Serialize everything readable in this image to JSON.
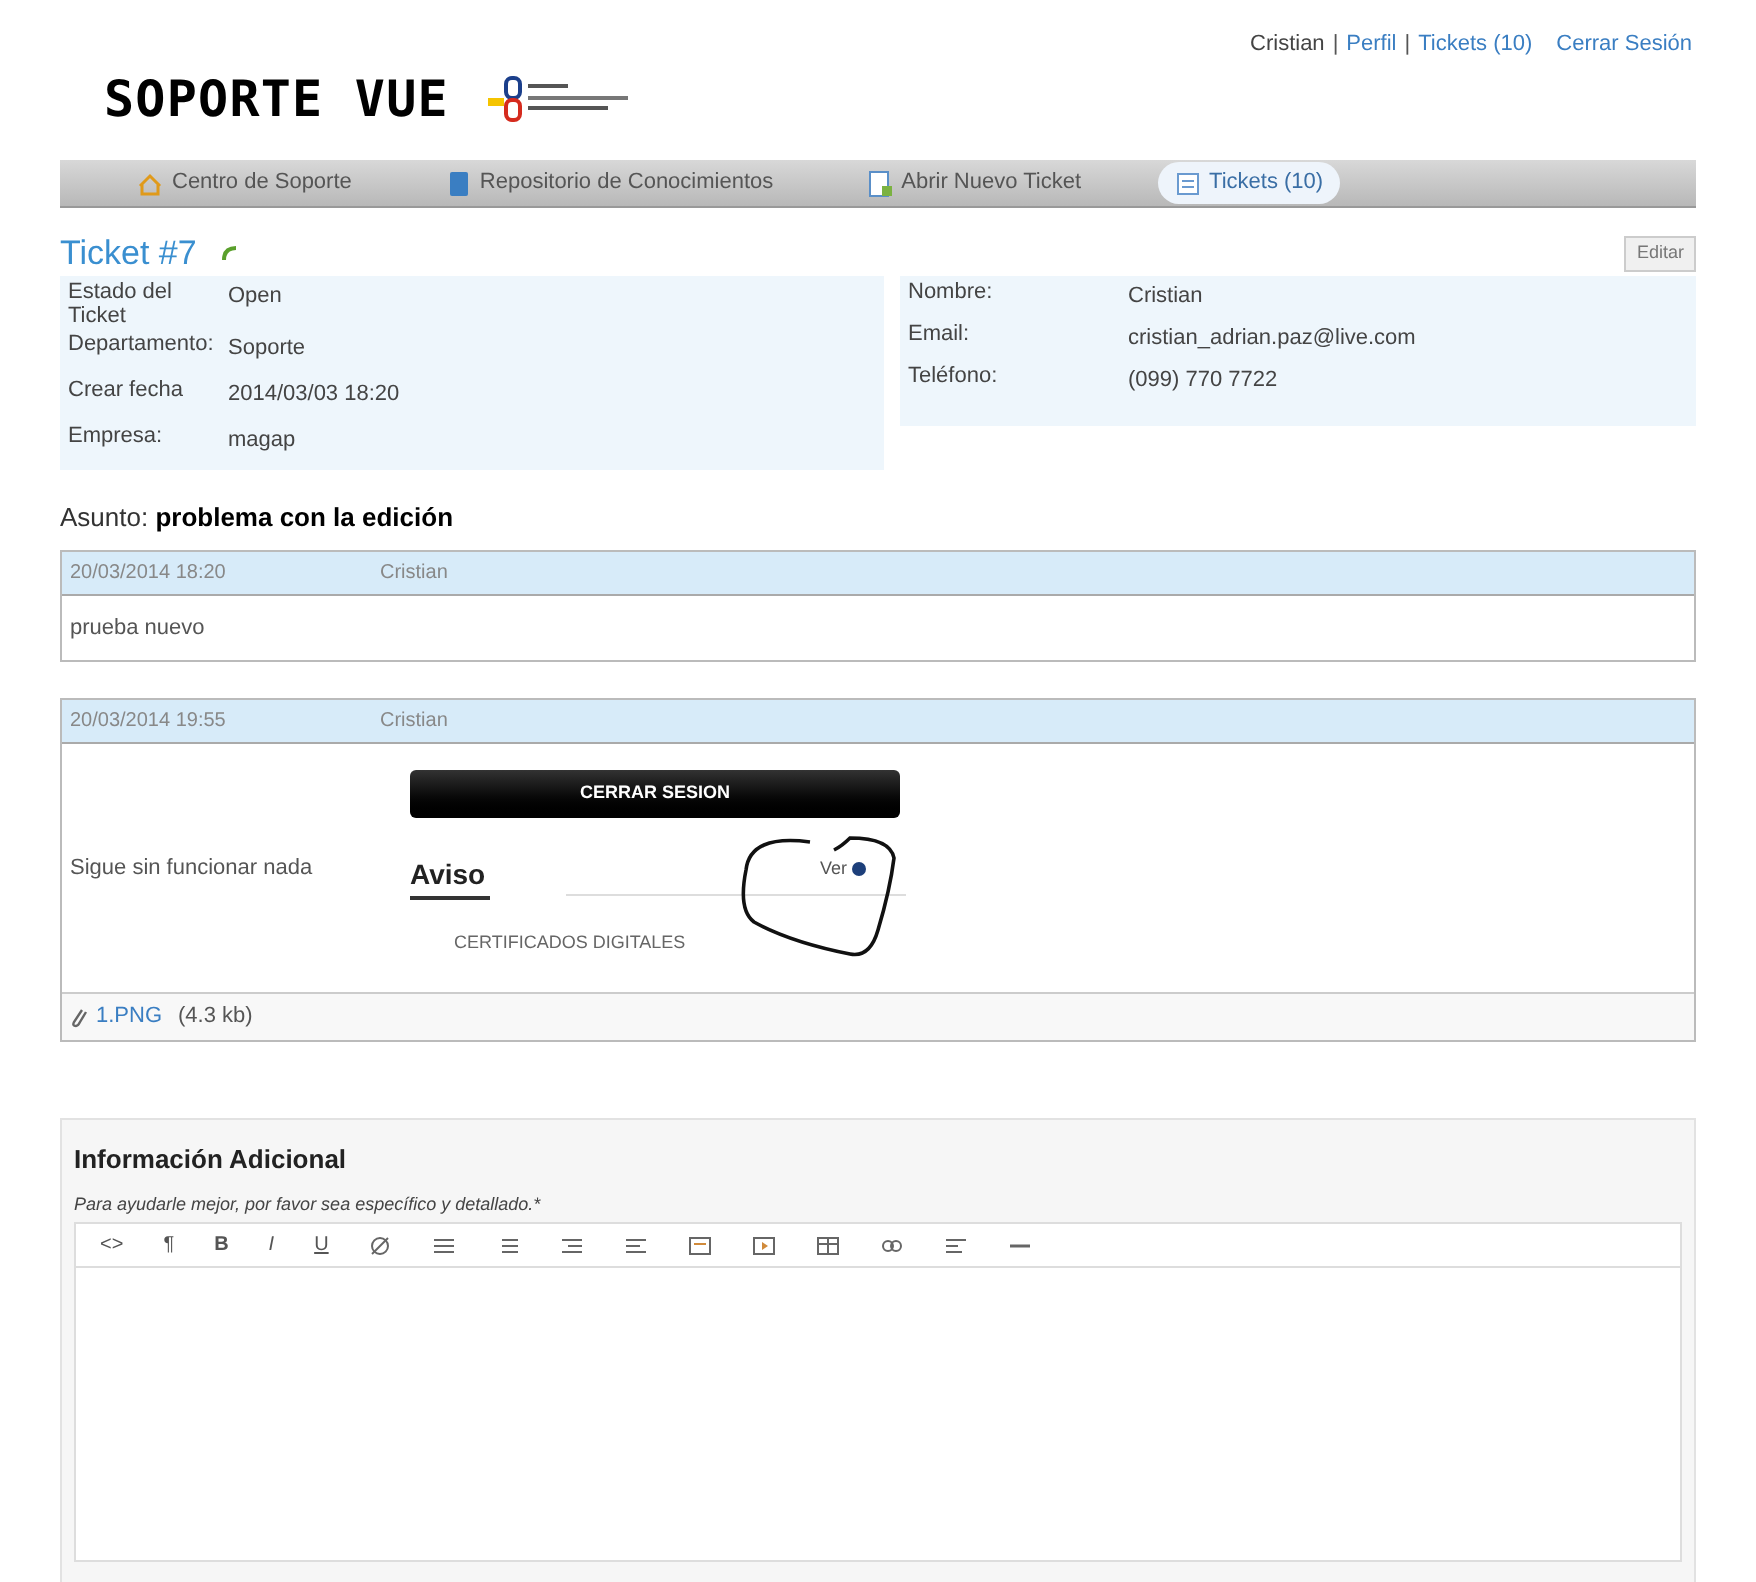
{
  "header": {
    "title": "SOPORTE VUE",
    "user_links": [
      {
        "label": "Cristian",
        "kind": "text"
      },
      {
        "label": "|",
        "kind": "separator"
      },
      {
        "label": "Perfil",
        "kind": "link"
      },
      {
        "label": "|",
        "kind": "separator"
      },
      {
        "label": "Tickets (10)",
        "kind": "link"
      },
      {
        "label": "Cerrar Sesión",
        "kind": "link"
      }
    ]
  },
  "nav": [
    {
      "label": "Centro de Soporte",
      "selected": false
    },
    {
      "label": "Repositorio de Conocimientos",
      "selected": false
    },
    {
      "label": "Abrir Nuevo Ticket",
      "selected": false
    },
    {
      "label": "Tickets (10)",
      "selected": true
    }
  ],
  "ticket": {
    "title": "Ticket #7",
    "edit_button": "Editar",
    "left_fields": [
      {
        "label": "Estado del Ticket",
        "value": "Open"
      },
      {
        "label": "Departamento:",
        "value": "Soporte"
      },
      {
        "label": "Crear fecha",
        "value": "2014/03/03 18:20"
      },
      {
        "label": "Empresa:",
        "value": "magap"
      }
    ],
    "right_fields": [
      {
        "label": "Nombre:",
        "value": "Cristian"
      },
      {
        "label": "Email:",
        "value": "cristian_adrian.paz@live.com"
      },
      {
        "label": "Teléfono:",
        "value": "(099) 770 7722"
      }
    ],
    "subject_label": "Asunto:",
    "subject": "problema con la edición"
  },
  "thread": [
    {
      "date": "20/03/2014 18:20",
      "author": "Cristian",
      "message": "prueba nuevo"
    },
    {
      "date": "20/03/2014 19:55",
      "author": "Cristian",
      "message": "Sigue sin funcionar nada",
      "embedded": {
        "button": "CERRAR SESION",
        "heading": "Aviso",
        "link": "Ver",
        "item": "CERTIFICADOS DIGITALES"
      },
      "attachment": "1.PNG",
      "attachment_size": "(4.3 kb)"
    }
  ],
  "additional": {
    "title": "Información Adicional",
    "hint": "Para ayudarle mejor, por favor sea específico y detallado.*",
    "toolbar": [
      "<>",
      "¶",
      "B",
      "I",
      "U"
    ]
  }
}
